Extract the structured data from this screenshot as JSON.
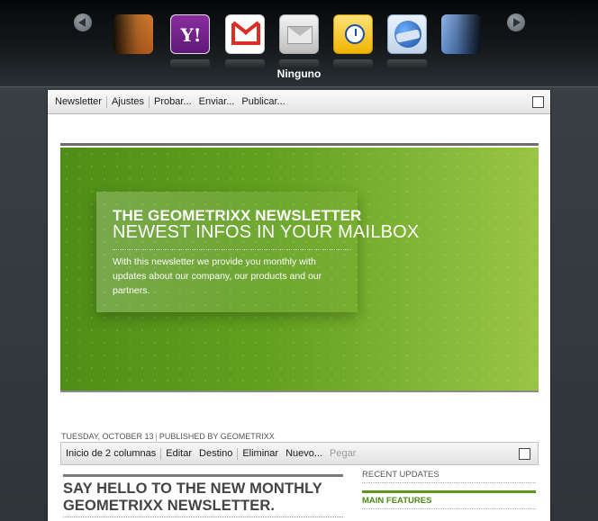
{
  "carousel": {
    "selected_label": "Ninguno",
    "clients": [
      {
        "name": "yahoo-mail",
        "glyph": "Y!"
      },
      {
        "name": "gmail",
        "glyph": ""
      },
      {
        "name": "ninguno",
        "glyph": ""
      },
      {
        "name": "outlook",
        "glyph": ""
      },
      {
        "name": "thunderbird",
        "glyph": ""
      }
    ]
  },
  "toolbar": {
    "items": [
      "Newsletter",
      "Ajustes",
      "Probar...",
      "Enviar...",
      "Publicar..."
    ]
  },
  "hero": {
    "title": "THE GEOMETRIXX NEWSLETTER",
    "subtitle": "NEWEST INFOS IN YOUR MAILBOX",
    "body": "With this newsletter we provide you monthly with updates about our company, our products and our partners.",
    "colors": {
      "green_dark": "#4f8d17",
      "green_light": "#9ac445"
    }
  },
  "dateline": {
    "date": "TUESDAY, OCTOBER 13",
    "published_by": "PUBLISHED BY GEOMETRIXX"
  },
  "paragraph_toolbar": {
    "items": [
      "Inicio de 2 columnas",
      "Editar",
      "Destino",
      "Eliminar",
      "Nuevo...",
      "Pegar"
    ]
  },
  "article": {
    "title": "SAY HELLO TO THE NEW MONTHLY GEOMETRIXX NEWSLETTER."
  },
  "sidebar": {
    "recent_updates": "RECENT UPDATES",
    "main_features": "MAIN FEATURES",
    "accent": "#5d9619"
  }
}
